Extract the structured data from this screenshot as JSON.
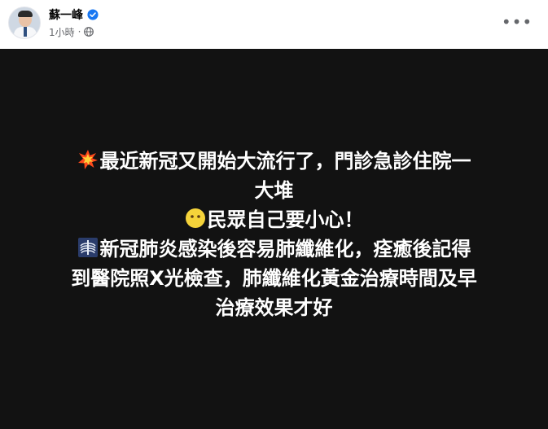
{
  "post": {
    "author_name": "蘇一峰",
    "timestamp": "1小時",
    "separator": "·",
    "more_label": "•••",
    "image_text": {
      "line1": "最近新冠又開始大流行了，門診急診住院一",
      "line2": "大堆",
      "line3": "民眾自己要小心！",
      "line4": "新冠肺炎感染後容易肺纖維化，痊癒後記得",
      "line5": "到醫院照X光檢查，肺纖維化黃金治療時間及早",
      "line6": "治療效果才好"
    }
  },
  "icons": {
    "verified": "verified-badge-icon",
    "privacy": "globe-icon",
    "more": "more-options-icon",
    "line1_emoji": "collision-emoji",
    "line3_emoji": "face-without-mouth-emoji",
    "line4_emoji": "x-ray-emoji"
  },
  "colors": {
    "image_background": "#121212",
    "text": "#ffffff",
    "verified_blue": "#1877f2",
    "meta_grey": "#65676b"
  }
}
